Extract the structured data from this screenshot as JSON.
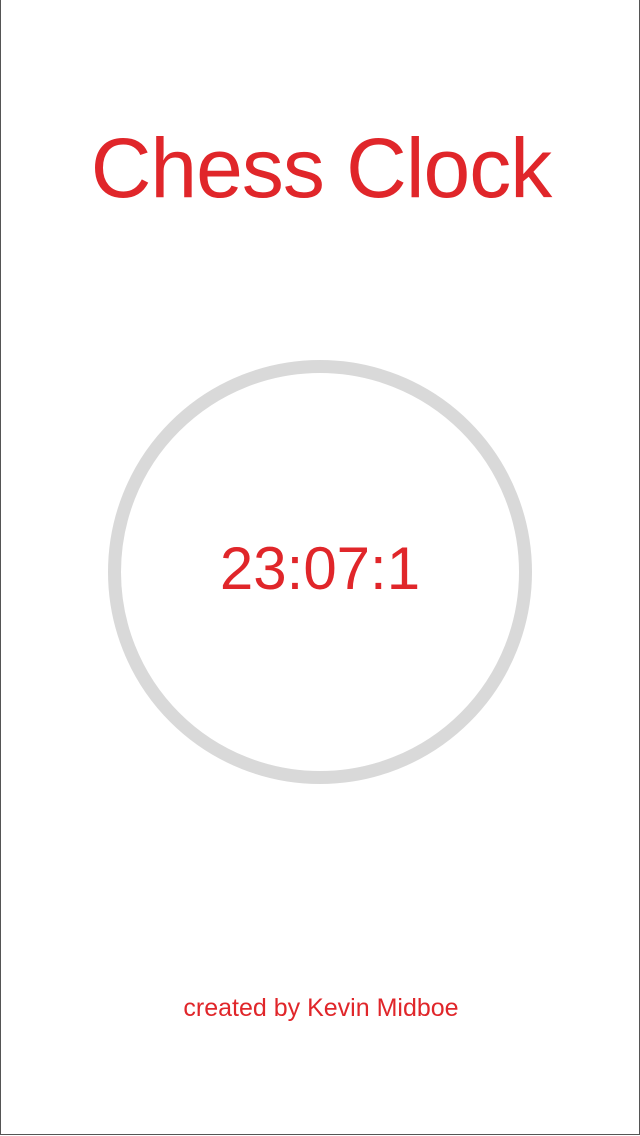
{
  "app": {
    "title": "Chess Clock",
    "credit": "created by Kevin Midboe"
  },
  "clock": {
    "time": "23:07:1"
  },
  "colors": {
    "accent": "#e0262a",
    "ring": "#d9d9d9",
    "background": "#ffffff"
  }
}
